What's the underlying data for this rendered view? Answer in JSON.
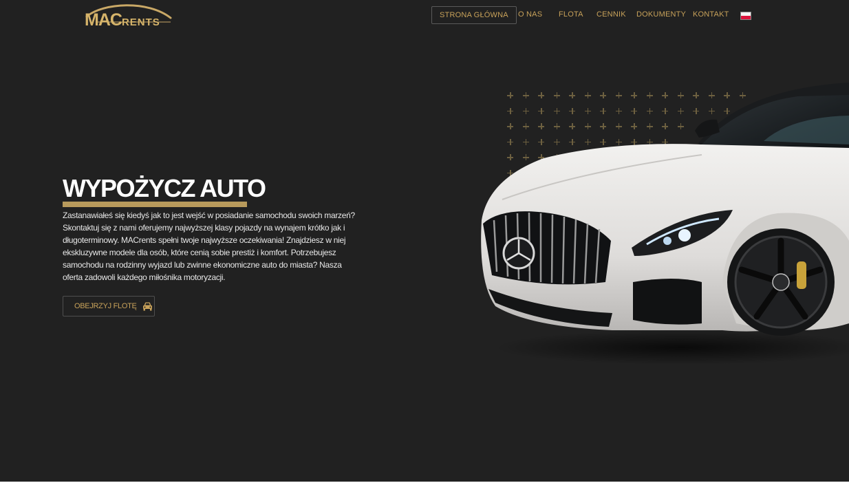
{
  "header": {
    "logo": {
      "text_main": "MAC",
      "text_small": "RENTS"
    },
    "nav": [
      {
        "label": "STRONA GŁÓWNA",
        "active": true
      },
      {
        "label": "O NAS"
      },
      {
        "label": "FLOTA"
      },
      {
        "label": "CENNIK"
      },
      {
        "label": "DOKUMENTY"
      },
      {
        "label": "KONTAKT"
      }
    ],
    "language_flag": "pl-flag-icon"
  },
  "hero": {
    "title": "WYPOŻYCZ AUTO",
    "description": "Zastanawiałeś się kiedyś jak to jest wejść w posiadanie samochodu swoich marzeń? Skontaktuj się z nami oferujemy najwyższej klasy pojazdy na wynajem krótko jak i długoterminowy. MACrents spełni twoje najwyższe oczekiwania! Znajdziesz w niej ekskluzywne modele dla osób, które cenią sobie prestiż i komfort. Potrzebujesz samochodu na rodzinny wyjazd lub zwinne ekonomiczne auto do miasta? Nasza oferta zadowoli każdego miłośnika motoryzacji.",
    "cta_label": "OBEJRZYJ FLOTĘ",
    "cta_icon": "car-front-icon",
    "image": "white-sports-car-image"
  },
  "colors": {
    "background": "#212121",
    "accent_gold": "#c8a25a",
    "underline_gold": "#b89a5c"
  }
}
